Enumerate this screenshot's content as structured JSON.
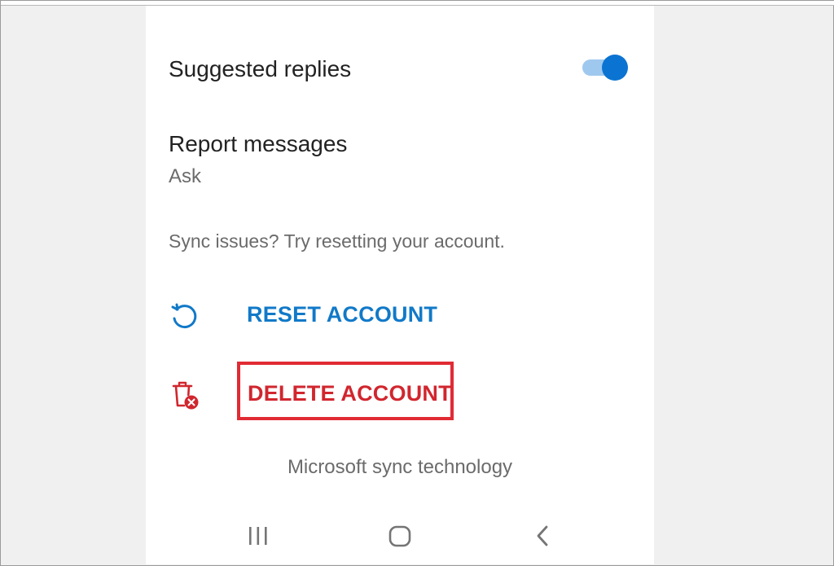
{
  "settings": {
    "suggested_replies": {
      "label": "Suggested replies",
      "enabled": true
    },
    "report_messages": {
      "label": "Report messages",
      "value": "Ask"
    },
    "sync_hint": "Sync issues? Try resetting your account.",
    "reset_action": {
      "label": "RESET ACCOUNT",
      "icon": "reset-icon",
      "color": "#1179c8"
    },
    "delete_action": {
      "label": "DELETE ACCOUNT",
      "icon": "delete-account-icon",
      "color": "#d1262e",
      "highlight_color": "#e12b34"
    },
    "footer": "Microsoft sync technology"
  },
  "nav_bar": {
    "items": [
      {
        "icon": "recent-apps-icon"
      },
      {
        "icon": "home-icon"
      },
      {
        "icon": "back-icon"
      }
    ]
  },
  "colors": {
    "accent": "#0b74d2",
    "background": "#f0f0f0",
    "surface": "#ffffff"
  }
}
